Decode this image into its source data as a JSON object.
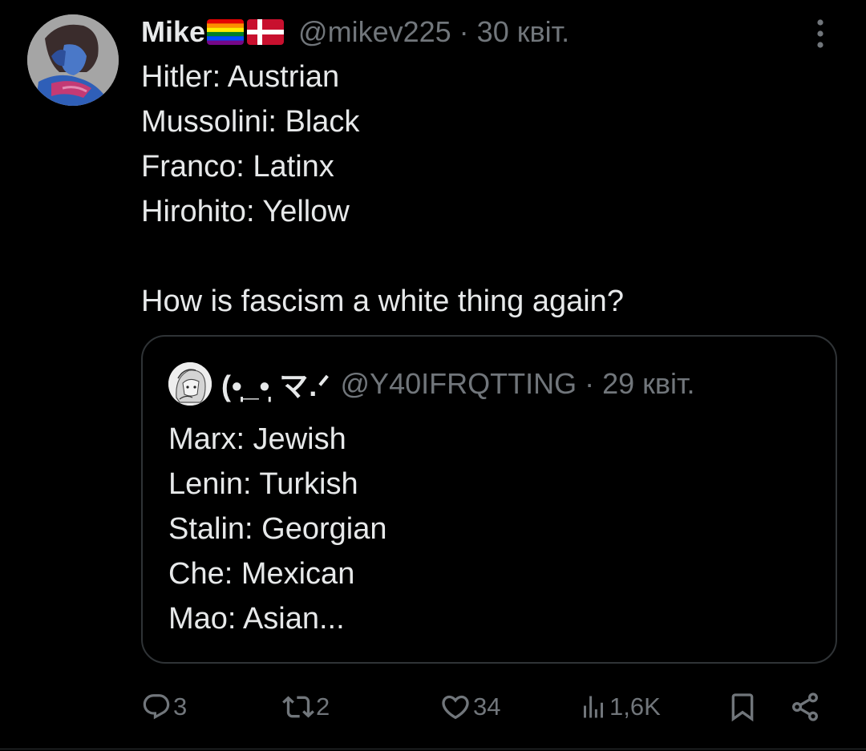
{
  "tweet": {
    "display_name": "Mike",
    "name_flags": [
      "rainbow-flag",
      "denmark-flag"
    ],
    "handle": "@mikev225",
    "separator": "·",
    "date": "30 квіт.",
    "more_icon": "more-vertical-icon",
    "lines": [
      "Hitler: Austrian",
      "Mussolini: Black",
      "Franco: Latinx",
      "Hirohito: Yellow",
      "",
      "How is fascism a white thing again?"
    ]
  },
  "quote": {
    "display_name": "(•̩̩̩̩_•̩̩̩̩ マ.ᐟ",
    "handle": "@Y40IFRQTTING",
    "separator": "·",
    "date": "29 квіт.",
    "lines": [
      "Marx: Jewish",
      "Lenin: Turkish",
      "Stalin: Georgian",
      "Che: Mexican",
      "Mao: Asian..."
    ]
  },
  "actions": {
    "replies": {
      "icon": "reply-icon",
      "count": "3"
    },
    "reposts": {
      "icon": "repost-icon",
      "count": "2"
    },
    "likes": {
      "icon": "heart-icon",
      "count": "34"
    },
    "views": {
      "icon": "views-icon",
      "count": "1,6K"
    },
    "bookmark": {
      "icon": "bookmark-icon"
    },
    "share": {
      "icon": "share-icon"
    }
  },
  "colors": {
    "background": "#000000",
    "text": "#e7e9ea",
    "muted": "#71767b",
    "border": "#2f3336"
  }
}
